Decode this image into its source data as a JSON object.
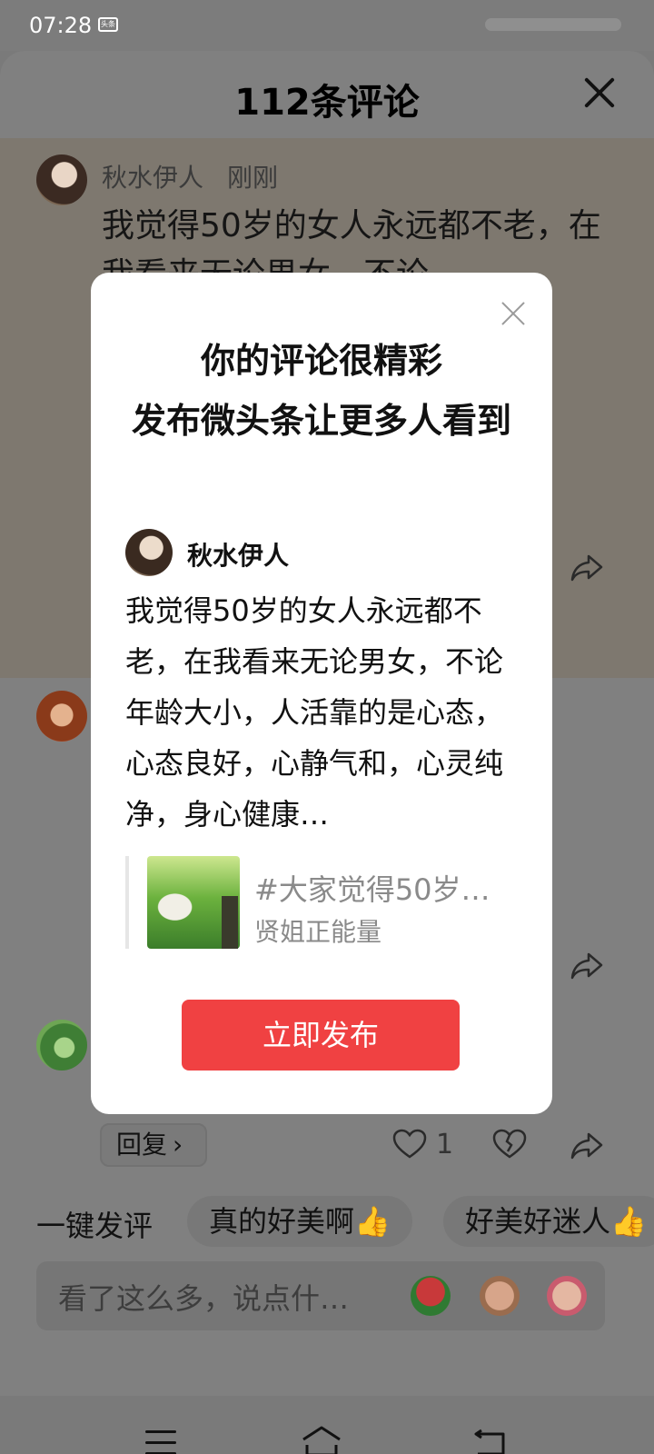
{
  "status_bar": {
    "time": "07:28",
    "app_badge": "头条"
  },
  "sheet": {
    "title": "112条评论",
    "comment1": {
      "author": "秋水伊人",
      "time": "刚刚",
      "text": "我觉得50岁的女人永远都不老，在我看来无论男女，不论"
    },
    "reply_button": "回复",
    "chevron": "›",
    "like_count": "1",
    "quick_reply_label": "一键发评",
    "quick_chips": [
      "真的好美啊👍",
      "好美好迷人👍"
    ],
    "input_placeholder": "看了这么多，说点什…"
  },
  "modal": {
    "title": "你的评论很精彩\n发布微头条让更多人看到",
    "title_line1": "你的评论很精彩",
    "title_line2": "发布微头条让更多人看到",
    "author": "秋水伊人",
    "text": "我觉得50岁的女人永远都不老，在我看来无论男女，不论年龄大小，人活靠的是心态，心态良好，心静气和，心灵纯净，身心健康…",
    "quote_title": "#大家觉得50岁…",
    "quote_source": "贤姐正能量",
    "publish_button": "立即发布"
  },
  "icons": {
    "close": "close-icon",
    "share": "share-icon",
    "like": "heart-icon",
    "dislike": "broken-heart-icon",
    "nav_menu": "menu-icon",
    "nav_home": "home-icon",
    "nav_back": "back-icon"
  }
}
